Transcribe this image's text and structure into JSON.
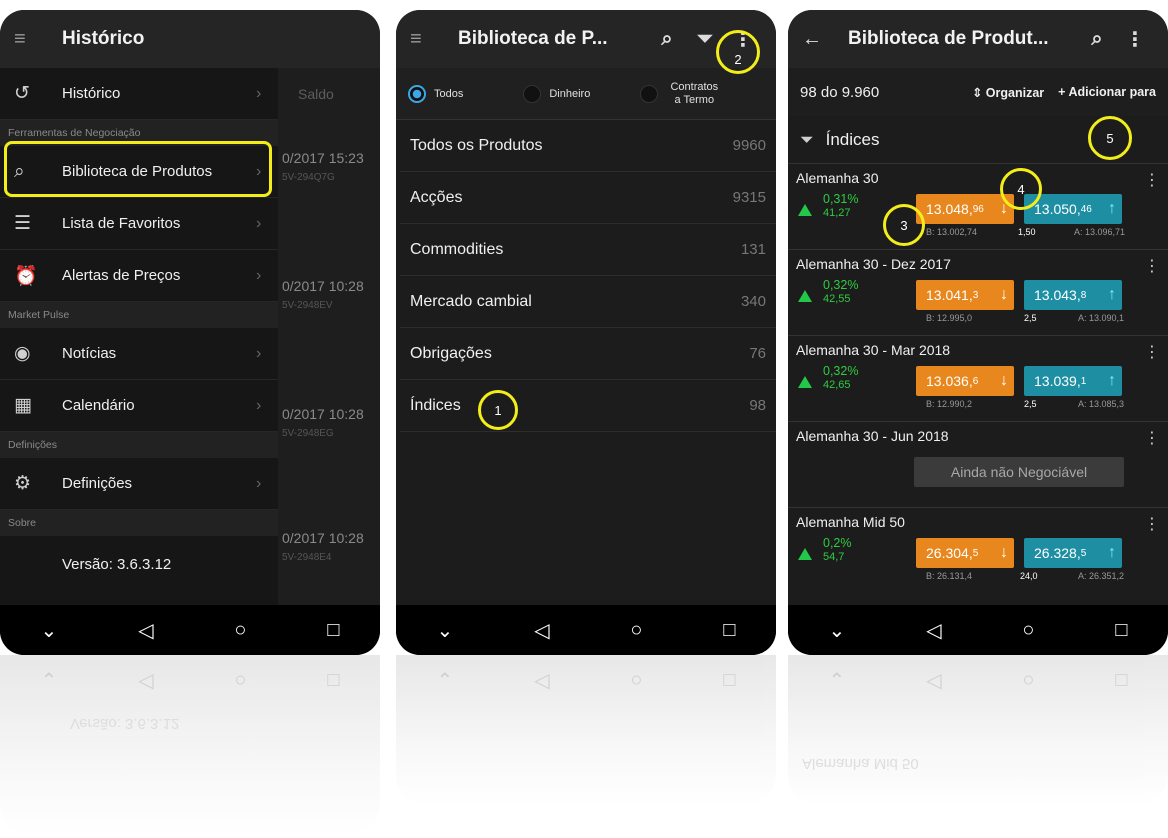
{
  "nav": {
    "menu": "≡",
    "back": "◁",
    "home": "○",
    "recent": "□",
    "down": "⌄"
  },
  "phone1": {
    "title": "Histórico",
    "sections": [
      "Ferramentas de Negociação",
      "Market Pulse",
      "Definições",
      "Sobre"
    ],
    "items": [
      {
        "label": "Histórico",
        "icon": "history-icon"
      },
      {
        "label": "Biblioteca de Produtos",
        "icon": "search-icon"
      },
      {
        "label": "Lista de Favoritos",
        "icon": "list-icon"
      },
      {
        "label": "Alertas de Preços",
        "icon": "alarm-clock-icon"
      },
      {
        "label": "Notícias",
        "icon": "news-icon"
      },
      {
        "label": "Calendário",
        "icon": "calendar-icon"
      },
      {
        "label": "Definições",
        "icon": "gear-icon"
      }
    ],
    "version": "Versão: 3.6.3.12",
    "background": {
      "saldo": "Saldo",
      "rows": [
        {
          "time": "0/2017 15:23",
          "code": "5V-294Q7G"
        },
        {
          "time": "0/2017 10:28",
          "code": "5V-2948EV"
        },
        {
          "time": "0/2017 10:28",
          "code": "5V-2948EG"
        },
        {
          "time": "0/2017 10:28",
          "code": "5V-2948E4"
        }
      ]
    }
  },
  "phone2": {
    "title": "Biblioteca de P...",
    "radios": [
      "Todos",
      "Dinheiro",
      "Contratos a Termo"
    ],
    "categories": [
      {
        "name": "Todos os Produtos",
        "count": "9960"
      },
      {
        "name": "Acções",
        "count": "9315"
      },
      {
        "name": "Commodities",
        "count": "131"
      },
      {
        "name": "Mercado cambial",
        "count": "340"
      },
      {
        "name": "Obrigações",
        "count": "76"
      },
      {
        "name": "Índices",
        "count": "98"
      }
    ],
    "callouts": [
      "1",
      "2"
    ]
  },
  "phone3": {
    "title": "Biblioteca de Produt...",
    "count": "98 do 9.960",
    "organize": "⇕ Organizar",
    "add": "+ Adicionar para",
    "filter": "Índices",
    "products": [
      {
        "name": "Alemanha 30",
        "pct": "0,31%",
        "chg": "41,27",
        "sell_main": "13.048,",
        "sell_sub": "96",
        "buy_main": "13.050,",
        "buy_sub": "46",
        "low": "B: 13.002,74",
        "spread": "1,50",
        "high": "A: 13.096,71"
      },
      {
        "name": "Alemanha 30 - Dez 2017",
        "pct": "0,32%",
        "chg": "42,55",
        "sell_main": "13.041,",
        "sell_sub": "3",
        "buy_main": "13.043,",
        "buy_sub": "8",
        "low": "B: 12.995,0",
        "spread": "2,5",
        "high": "A: 13.090,1"
      },
      {
        "name": "Alemanha 30 - Mar 2018",
        "pct": "0,32%",
        "chg": "42,65",
        "sell_main": "13.036,",
        "sell_sub": "6",
        "buy_main": "13.039,",
        "buy_sub": "1",
        "low": "B: 12.990,2",
        "spread": "2,5",
        "high": "A: 13.085,3"
      },
      {
        "name": "Alemanha 30 - Jun 2018",
        "notrade": "Ainda não Negociável"
      },
      {
        "name": "Alemanha Mid 50",
        "pct": "0,2%",
        "chg": "54,7",
        "sell_main": "26.304,",
        "sell_sub": "5",
        "buy_main": "26.328,",
        "buy_sub": "5",
        "low": "B: 26.131,4",
        "spread": "24,0",
        "high": "A: 26.351,2"
      }
    ],
    "callouts": [
      "3",
      "4",
      "5"
    ]
  }
}
